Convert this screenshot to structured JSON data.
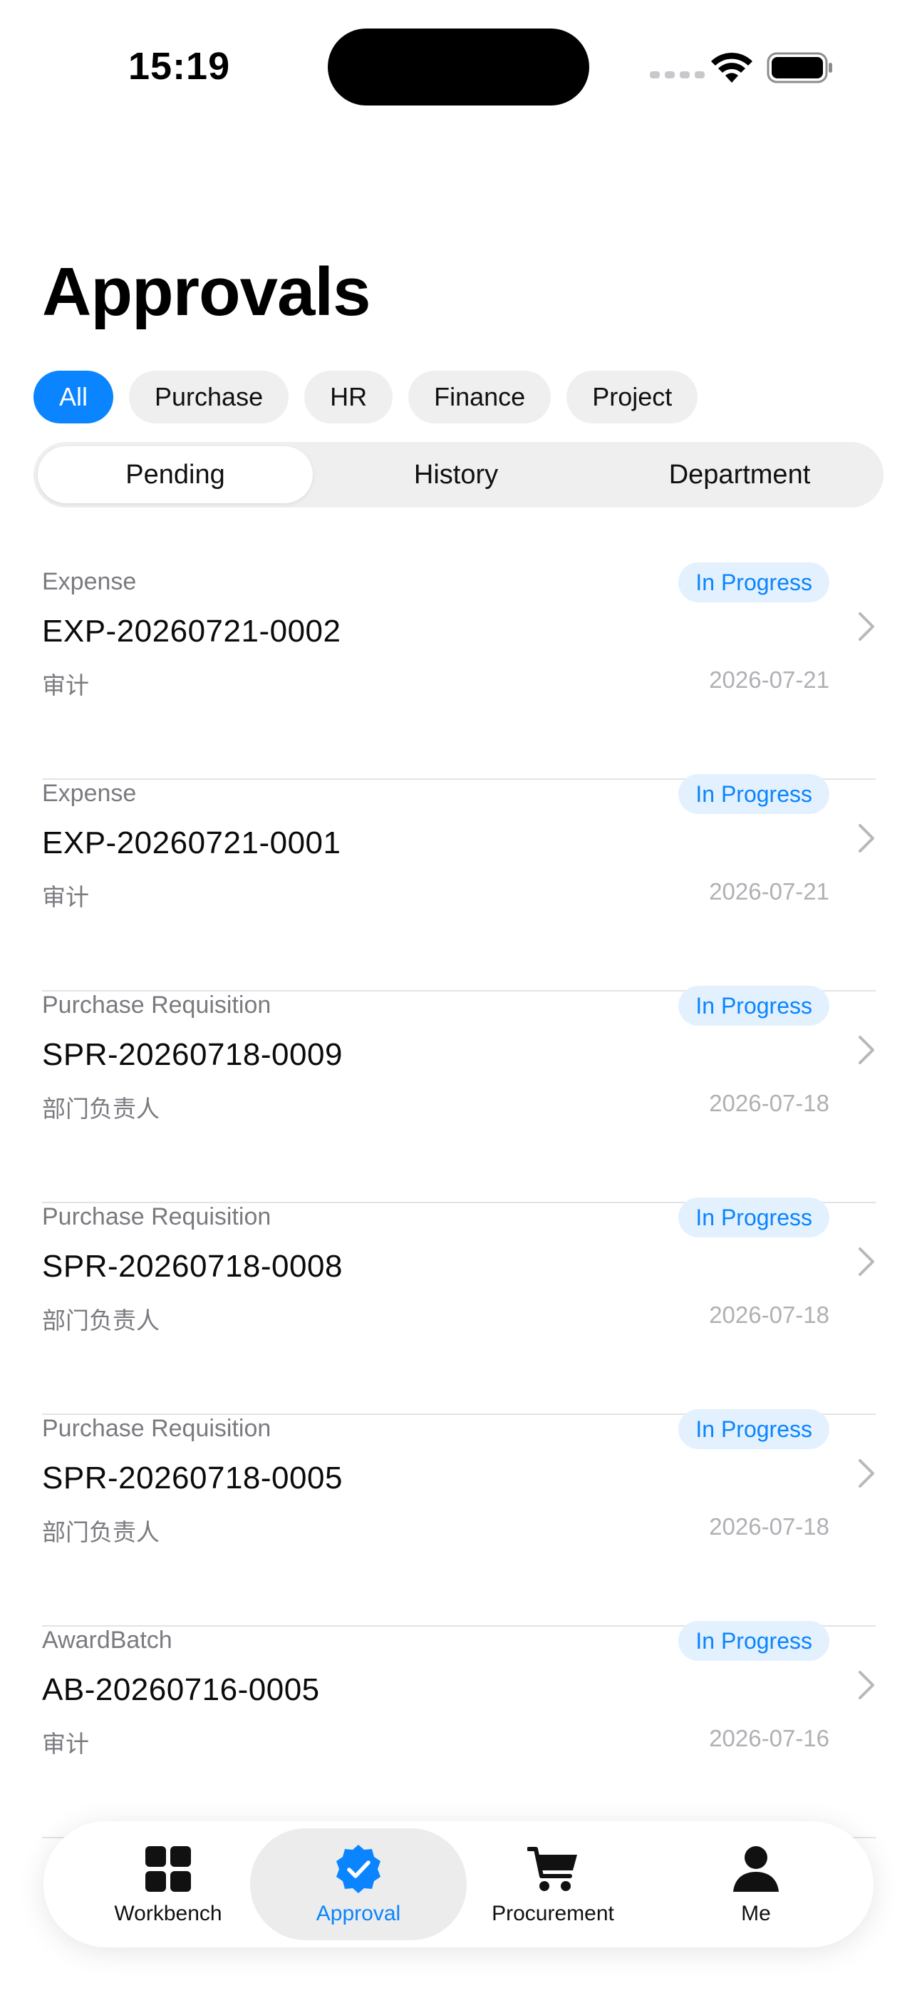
{
  "status_bar": {
    "time": "15:19"
  },
  "page": {
    "title": "Approvals"
  },
  "filters": {
    "chips": [
      {
        "label": "All",
        "active": true
      },
      {
        "label": "Purchase",
        "active": false
      },
      {
        "label": "HR",
        "active": false
      },
      {
        "label": "Finance",
        "active": false
      },
      {
        "label": "Project",
        "active": false
      }
    ]
  },
  "segments": {
    "items": [
      {
        "label": "Pending",
        "active": true
      },
      {
        "label": "History",
        "active": false
      },
      {
        "label": "Department",
        "active": false
      }
    ]
  },
  "approvals": [
    {
      "type": "Expense",
      "id": "EXP-20260721-0002",
      "node": "审计",
      "date": "2026-07-21",
      "status": "In Progress"
    },
    {
      "type": "Expense",
      "id": "EXP-20260721-0001",
      "node": "审计",
      "date": "2026-07-21",
      "status": "In Progress"
    },
    {
      "type": "Purchase Requisition",
      "id": "SPR-20260718-0009",
      "node": "部门负责人",
      "date": "2026-07-18",
      "status": "In Progress"
    },
    {
      "type": "Purchase Requisition",
      "id": "SPR-20260718-0008",
      "node": "部门负责人",
      "date": "2026-07-18",
      "status": "In Progress"
    },
    {
      "type": "Purchase Requisition",
      "id": "SPR-20260718-0005",
      "node": "部门负责人",
      "date": "2026-07-18",
      "status": "In Progress"
    },
    {
      "type": "AwardBatch",
      "id": "AB-20260716-0005",
      "node": "审计",
      "date": "2026-07-16",
      "status": "In Progress"
    }
  ],
  "tabbar": {
    "items": [
      {
        "label": "Workbench",
        "icon": "grid-icon",
        "active": false
      },
      {
        "label": "Approval",
        "icon": "check-seal-icon",
        "active": true
      },
      {
        "label": "Procurement",
        "icon": "cart-icon",
        "active": false
      },
      {
        "label": "Me",
        "icon": "person-icon",
        "active": false
      }
    ]
  },
  "colors": {
    "accent": "#0a84ff",
    "badge_bg": "#e3f1ff",
    "chip_bg": "#efefef"
  }
}
